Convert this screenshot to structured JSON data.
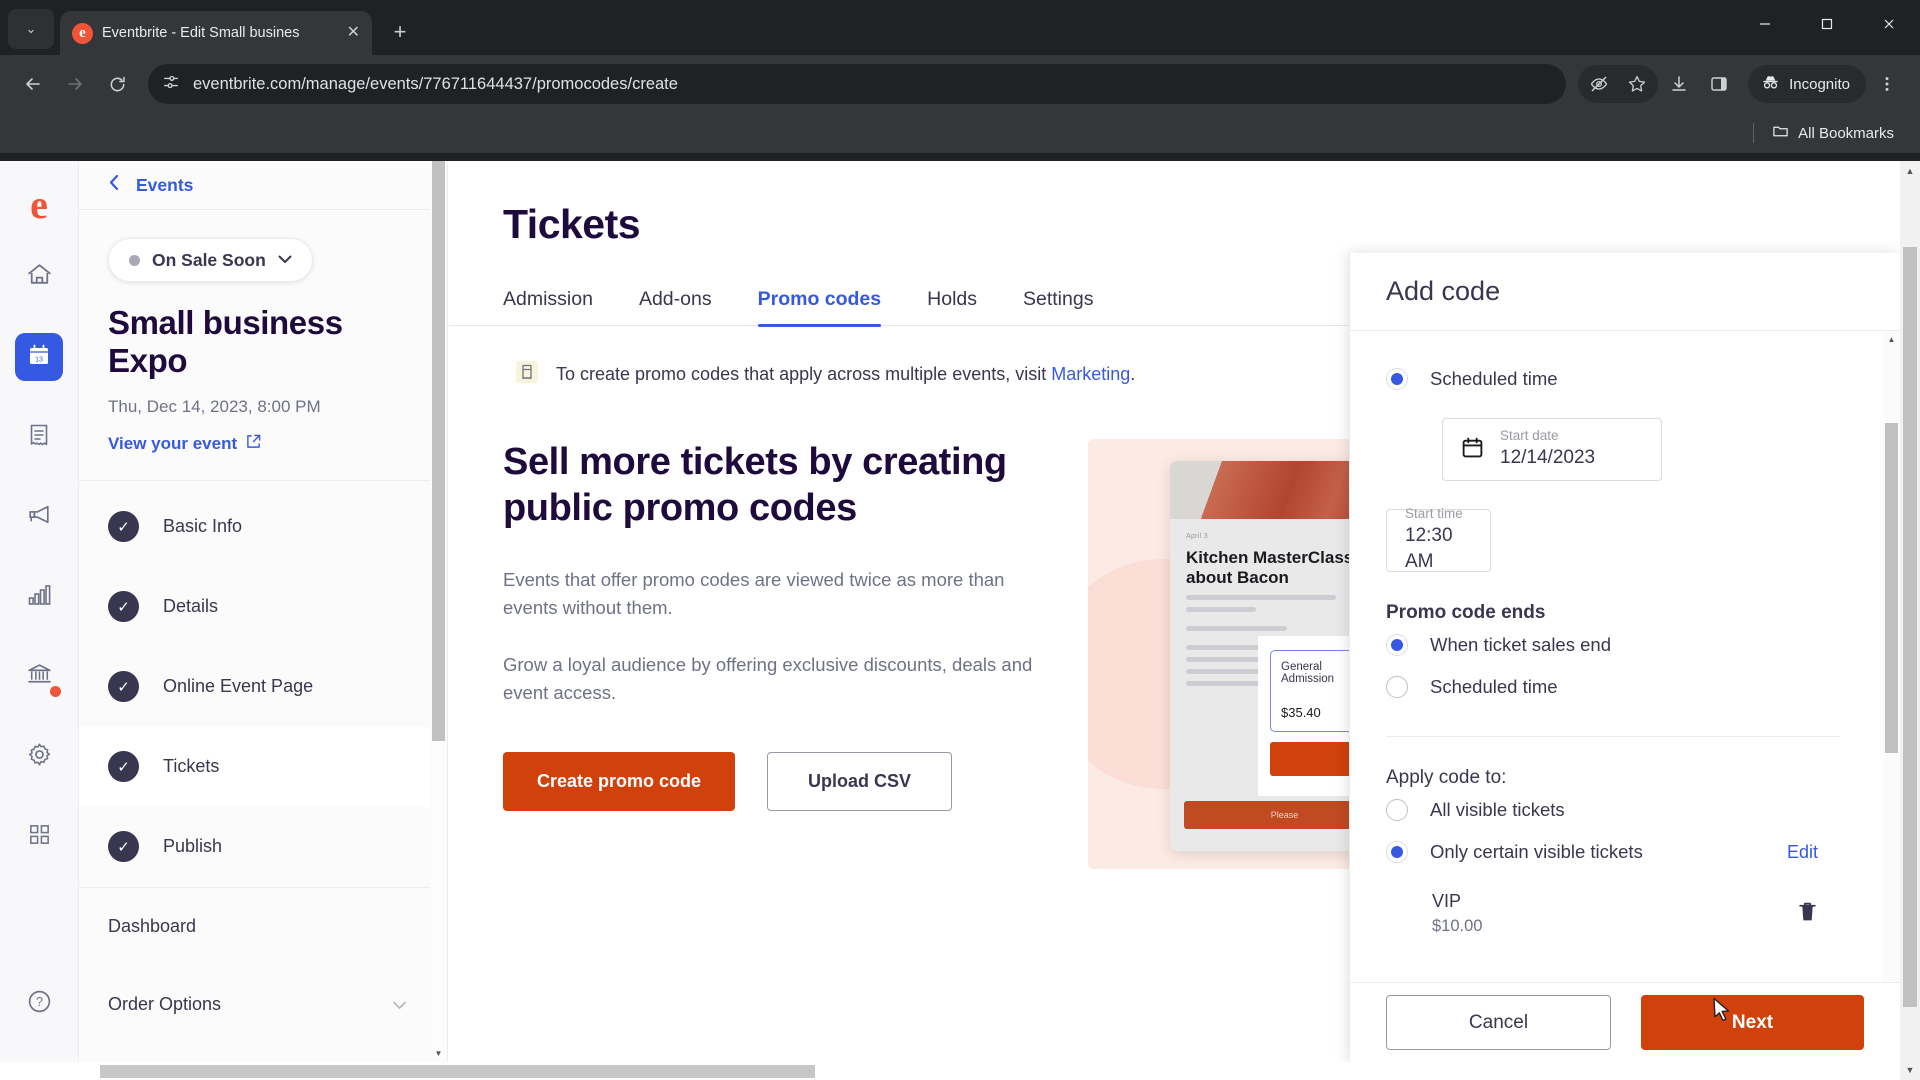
{
  "browser": {
    "tab": {
      "title": "Eventbrite - Edit Small busines",
      "favicon": "eventbrite-logo-icon",
      "close": "✕"
    },
    "new_tab_label": "+",
    "tab_list_chevron": "⌄",
    "window_controls": {
      "minimize": "—",
      "maximize": "❐",
      "close": "✕"
    },
    "nav": {
      "back": "←",
      "forward": "→",
      "reload": "⟳"
    },
    "omnibox": {
      "url": "eventbrite.com/manage/events/776711644437/promocodes/create",
      "site_info_icon": "tune-icon"
    },
    "toolbar_icons": [
      "eye-off-icon",
      "star-icon",
      "download-icon",
      "side-panel-icon",
      "kebab-menu-icon"
    ],
    "profile": {
      "label": "Incognito",
      "icon": "incognito-hat-icon"
    },
    "bookmarks": {
      "label": "All Bookmarks",
      "icon": "folder-icon"
    }
  },
  "rail": {
    "logo": "e",
    "items": [
      {
        "name": "home",
        "icon": "home-icon"
      },
      {
        "name": "events",
        "icon": "calendar-icon",
        "active": true
      },
      {
        "name": "orders",
        "icon": "receipt-icon"
      },
      {
        "name": "marketing",
        "icon": "megaphone-icon"
      },
      {
        "name": "reports",
        "icon": "bar-chart-icon"
      },
      {
        "name": "finance",
        "icon": "bank-icon",
        "badge": true
      },
      {
        "name": "settings",
        "icon": "gear-icon"
      },
      {
        "name": "apps",
        "icon": "grid-icon"
      }
    ],
    "help": {
      "name": "help",
      "icon": "question-circle-icon"
    }
  },
  "sidebar": {
    "back_label": "Events",
    "status": {
      "label": "On Sale Soon",
      "caret": "⌄",
      "dot_color": "#a9a8b3"
    },
    "event_title": "Small business Expo",
    "event_date": "Thu, Dec 14, 2023, 8:00 PM",
    "view_event_label": "View your event",
    "view_event_icon": "external-link-icon",
    "steps": [
      {
        "label": "Basic Info",
        "done": true,
        "active": false
      },
      {
        "label": "Details",
        "done": true,
        "active": false
      },
      {
        "label": "Online Event Page",
        "done": true,
        "active": false
      },
      {
        "label": "Tickets",
        "done": true,
        "active": true
      },
      {
        "label": "Publish",
        "done": true,
        "active": false
      }
    ],
    "nav_items": [
      {
        "label": "Dashboard",
        "caret": ""
      },
      {
        "label": "Order Options",
        "caret": "⌄"
      }
    ]
  },
  "main": {
    "page_title": "Tickets",
    "tabs": [
      {
        "label": "Admission",
        "active": false
      },
      {
        "label": "Add-ons",
        "active": false
      },
      {
        "label": "Promo codes",
        "active": true
      },
      {
        "label": "Holds",
        "active": false
      },
      {
        "label": "Settings",
        "active": false
      }
    ],
    "notice": {
      "icon": "ticket-icon",
      "text_before": "To create promo codes that apply across multiple events, visit ",
      "link": "Marketing",
      "text_after": "."
    },
    "hero": {
      "heading": "Sell more tickets by creating public promo codes",
      "paragraph_1": "Events that offer promo codes are viewed twice as more than events without them.",
      "paragraph_2": "Grow a loyal audience by offering exclusive discounts, deals and event access.",
      "primary_button": "Create promo code",
      "secondary_button": "Upload CSV"
    },
    "illustration": {
      "phone_eyebrow": "April 3",
      "phone_title": "Kitchen MasterClass about Bacon",
      "card_select_label": "General Admission",
      "card_select_price": "$35.40",
      "card_cta": "",
      "phone_cta": "Please"
    }
  },
  "modal": {
    "title": "Add code",
    "start_radio": {
      "label": "Scheduled time",
      "selected": true
    },
    "start_date": {
      "label": "Start date",
      "value": "12/14/2023",
      "icon": "calendar-icon"
    },
    "start_time": {
      "label": "Start time",
      "value": "12:30 AM"
    },
    "ends_section_title": "Promo code ends",
    "ends_options": [
      {
        "label": "When ticket sales end",
        "selected": true
      },
      {
        "label": "Scheduled time",
        "selected": false
      }
    ],
    "apply_section_title": "Apply code to:",
    "apply_options": [
      {
        "label": "All visible tickets",
        "selected": false
      },
      {
        "label": "Only certain visible tickets",
        "selected": true,
        "action": "Edit"
      }
    ],
    "selected_tickets": [
      {
        "name": "VIP",
        "price": "$10.00",
        "delete_icon": "trash-icon"
      }
    ],
    "footer": {
      "cancel": "Cancel",
      "next": "Next"
    }
  },
  "colors": {
    "brand_orange": "#d1410c",
    "brand_blue": "#3659e3",
    "eventbrite_red": "#f05537",
    "dark_purple": "#1e0a3c",
    "text_gray": "#6f7287"
  }
}
